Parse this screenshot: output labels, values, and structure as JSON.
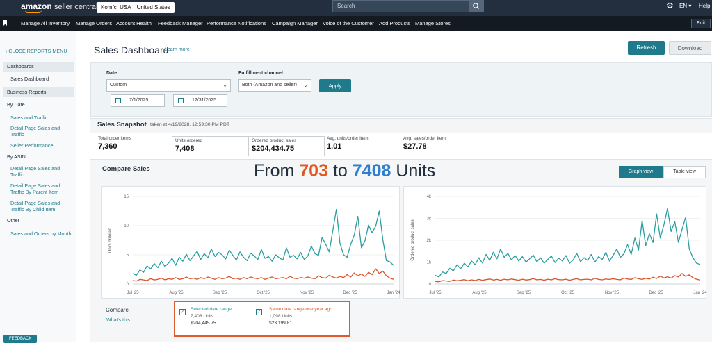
{
  "top_bar": {
    "logo_word": "amazon",
    "logo_product": "seller central",
    "account_name": "Komfc_USA",
    "account_region": "United States",
    "search_placeholder": "Search",
    "language": "EN",
    "help": "Help"
  },
  "nav": {
    "items": [
      "Manage All Inventory",
      "Manage Orders",
      "Account Health",
      "Feedback Manager",
      "Performance Notifications",
      "Campaign Manager",
      "Voice of the Customer",
      "Add Products",
      "Manage Stores"
    ],
    "edit": "Edit"
  },
  "sidebar": {
    "close_menu": "CLOSE REPORTS MENU",
    "dashboards": "Dashboards",
    "sales_dashboard": "Sales Dashboard",
    "business_reports": "Business Reports",
    "by_date": "By Date",
    "sales_and_traffic": "Sales and Traffic",
    "detail_page_sales_traffic": "Detail Page Sales and Traffic",
    "seller_performance": "Seller Performance",
    "by_asin": "By ASIN",
    "asin_detail_page": "Detail Page Sales and Traffic",
    "asin_parent": "Detail Page Sales and Traffic By Parent Item",
    "asin_child": "Detail Page Sales and Traffic By Child Item",
    "other": "Other",
    "sales_orders_month": "Sales and Orders by Month",
    "feedback": "FEEDBACK"
  },
  "page": {
    "title": "Sales Dashboard",
    "learn_more": "Learn more",
    "refresh": "Refresh",
    "download": "Download"
  },
  "filters": {
    "date_label": "Date",
    "date_value": "Custom",
    "start_date": "7/1/2025",
    "end_date": "12/31/2025",
    "channel_label": "Fulfillment channel",
    "channel_value": "Both (Amazon and seller)",
    "apply": "Apply"
  },
  "snapshot": {
    "title": "Sales Snapshot",
    "taken_at": "taken at 4/19/2028, 12:59:30 PM PDT",
    "metrics": [
      {
        "label": "Total order items",
        "value": "7,360"
      },
      {
        "label": "Units ordered",
        "value": "7,408"
      },
      {
        "label": "Ordered product sales",
        "value": "$204,434.75"
      },
      {
        "label": "Avg. units/order item",
        "value": "1.01"
      },
      {
        "label": "Avg. sales/order item",
        "value": "$27.78"
      }
    ]
  },
  "compare": {
    "title": "Compare Sales",
    "headline_from": "From",
    "headline_n1": "703",
    "headline_to": "to",
    "headline_n2": "7408",
    "headline_units": "Units",
    "graph_view": "Graph view",
    "table_view": "Table view",
    "compare_label": "Compare",
    "whats_this": "What's this",
    "selected_label": "Selected date range",
    "selected_units": "7,408 Units",
    "selected_sales": "$204,445.75",
    "prior_label": "Same date range one year ago",
    "prior_units": "1,098 Units",
    "prior_sales": "$23,199.81",
    "check_mark": "✓"
  },
  "colors": {
    "selected_series": "#2a9d9f",
    "prior_series": "#d9542a",
    "accent": "#1f7a8c"
  },
  "chart_data": [
    {
      "type": "line",
      "ylabel": "Units ordered",
      "yticks": [
        "0",
        "5",
        "10",
        "15"
      ],
      "ylim": [
        0,
        15
      ],
      "xticks": [
        "Jul '25",
        "Aug '25",
        "Sep '25",
        "Oct '25",
        "Nov '25",
        "Dec '25",
        "Jan '24"
      ],
      "series": [
        {
          "values": [
            1.8,
            1.5,
            2.4,
            2.0,
            3.1,
            2.6,
            3.5,
            2.8,
            3.9,
            3.0,
            3.6,
            4.4,
            3.2,
            4.6,
            3.9,
            5.1,
            4.0,
            4.8,
            5.6,
            4.2,
            5.2,
            4.5,
            6.0,
            4.7,
            5.4,
            5.0,
            4.3,
            5.8,
            4.9,
            4.1,
            5.5,
            4.6,
            4.0,
            5.3,
            4.8,
            4.2,
            5.9,
            4.4,
            4.7,
            3.9,
            5.0,
            4.5,
            4.1,
            6.2,
            4.6,
            4.9,
            4.3,
            5.4,
            4.2,
            4.8,
            6.5,
            5.2,
            4.9,
            8.0,
            6.8,
            5.5,
            9.2,
            12.8,
            7.0,
            5.0,
            4.6,
            6.8,
            8.4,
            11.6,
            6.2,
            7.4,
            10.1,
            8.8,
            9.9,
            12.5,
            7.6,
            4.0,
            3.8,
            3.2
          ]
        },
        {
          "values": [
            0.6,
            0.5,
            0.8,
            0.7,
            0.6,
            0.9,
            0.7,
            0.8,
            1.0,
            0.7,
            0.9,
            0.8,
            1.1,
            0.8,
            0.9,
            1.2,
            0.9,
            1.0,
            0.8,
            1.1,
            0.9,
            1.2,
            1.0,
            0.8,
            1.1,
            0.9,
            1.0,
            1.3,
            0.9,
            1.0,
            0.8,
            1.1,
            0.9,
            1.2,
            1.0,
            0.9,
            1.1,
            0.8,
            1.0,
            1.2,
            0.9,
            1.0,
            1.1,
            0.9,
            1.3,
            1.0,
            0.9,
            1.1,
            1.0,
            1.2,
            1.0,
            0.9,
            1.4,
            1.1,
            1.0,
            1.5,
            1.2,
            1.0,
            1.3,
            1.1,
            1.6,
            1.2,
            1.9,
            1.4,
            1.7,
            1.3,
            2.0,
            1.6,
            2.6,
            1.8,
            2.2,
            1.4,
            1.0,
            0.8
          ]
        }
      ]
    },
    {
      "type": "line",
      "ylabel": "Ordered product sales",
      "yticks": [
        "0",
        "1k",
        "2k",
        "3k",
        "4k"
      ],
      "ylim": [
        0,
        4
      ],
      "xticks": [
        "Jul '25",
        "Aug '25",
        "Sep '25",
        "Oct '25",
        "Nov '25",
        "Dec '25",
        "Jan '24"
      ],
      "series": [
        {
          "values": [
            0.4,
            0.32,
            0.55,
            0.48,
            0.72,
            0.6,
            0.88,
            0.7,
            0.95,
            0.78,
            1.05,
            0.88,
            1.2,
            0.96,
            1.35,
            1.08,
            1.45,
            1.15,
            1.6,
            1.22,
            1.4,
            1.1,
            1.3,
            1.05,
            1.25,
            1.0,
            1.15,
            1.32,
            1.02,
            1.2,
            0.95,
            1.12,
            1.28,
            0.98,
            1.18,
            1.05,
            1.3,
            0.95,
            1.1,
            1.4,
            1.02,
            1.2,
            1.08,
            1.35,
            1.0,
            1.25,
            1.12,
            1.45,
            1.05,
            1.3,
            1.6,
            1.22,
            1.38,
            1.8,
            1.35,
            2.1,
            1.55,
            2.9,
            1.75,
            2.3,
            1.9,
            3.2,
            2.1,
            2.7,
            3.45,
            2.4,
            2.85,
            1.9,
            2.5,
            3.05,
            1.6,
            1.2,
            0.95,
            0.9
          ]
        },
        {
          "values": [
            0.12,
            0.1,
            0.16,
            0.14,
            0.12,
            0.18,
            0.15,
            0.17,
            0.2,
            0.15,
            0.19,
            0.16,
            0.21,
            0.17,
            0.2,
            0.23,
            0.18,
            0.21,
            0.17,
            0.22,
            0.19,
            0.23,
            0.2,
            0.17,
            0.22,
            0.18,
            0.2,
            0.25,
            0.19,
            0.21,
            0.17,
            0.22,
            0.19,
            0.24,
            0.2,
            0.19,
            0.22,
            0.17,
            0.21,
            0.24,
            0.19,
            0.21,
            0.22,
            0.19,
            0.26,
            0.21,
            0.19,
            0.23,
            0.21,
            0.24,
            0.21,
            0.19,
            0.27,
            0.23,
            0.21,
            0.29,
            0.24,
            0.21,
            0.26,
            0.23,
            0.31,
            0.25,
            0.36,
            0.28,
            0.33,
            0.27,
            0.38,
            0.32,
            0.48,
            0.35,
            0.42,
            0.29,
            0.22,
            0.18
          ]
        }
      ]
    }
  ]
}
